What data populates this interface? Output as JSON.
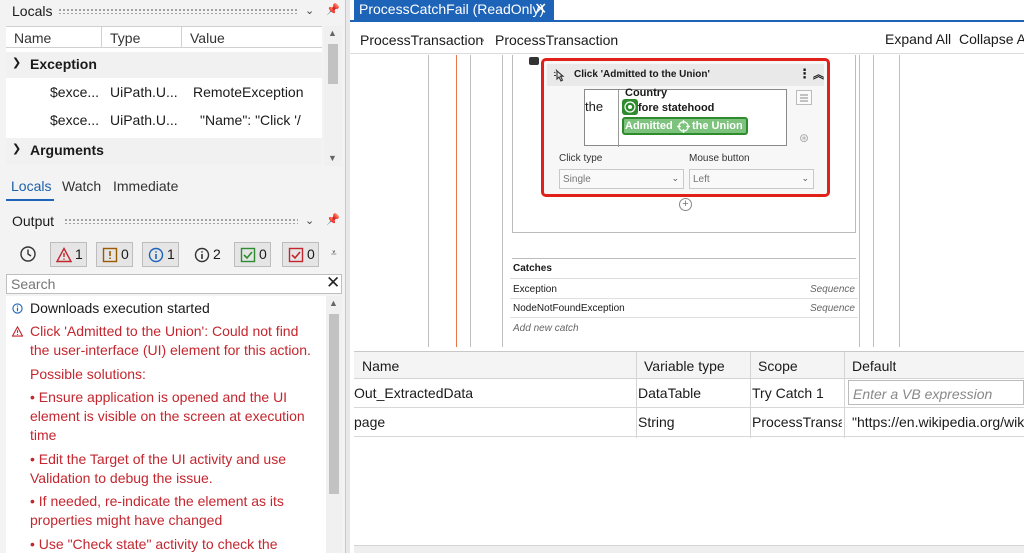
{
  "locals_panel": {
    "title": "Locals",
    "columns": [
      "Name",
      "Type",
      "Value"
    ],
    "groups": [
      {
        "label": "Exception",
        "rows": [
          {
            "name": "$exce...",
            "type": "UiPath.U...",
            "value": "RemoteException"
          },
          {
            "name": "$exce...",
            "type": "UiPath.U...",
            "value": "\"Name\": \"Click '/"
          }
        ]
      },
      {
        "label": "Arguments",
        "rows": []
      }
    ],
    "tabs": [
      "Locals",
      "Watch",
      "Immediate"
    ]
  },
  "output_panel": {
    "title": "Output",
    "filters": [
      {
        "icon": "warning-triangle-icon",
        "count": "1",
        "color": "#c4262e"
      },
      {
        "icon": "error-square-icon",
        "count": "0",
        "color": "#9a5a00"
      },
      {
        "icon": "info-circle-icon",
        "count": "1",
        "color": "#1d63b8"
      },
      {
        "icon": "info-outline-icon",
        "count": "2",
        "color": "#333333"
      },
      {
        "icon": "check-square-icon",
        "count": "0",
        "color": "#2e8b2e"
      },
      {
        "icon": "check-square-red-icon",
        "count": "0",
        "color": "#c4262e"
      }
    ],
    "search_placeholder": "Search",
    "lines": [
      {
        "text": "Downloads execution started",
        "kind": "info"
      },
      {
        "text": "Click 'Admitted to the Union': Could not find",
        "kind": "error"
      },
      {
        "text": "the user-interface (UI) element for this action.",
        "kind": "error-cont"
      },
      {
        "text": "Possible solutions:",
        "kind": "error-cont"
      },
      {
        "text": "•  Ensure application is opened and the UI",
        "kind": "error-bullet"
      },
      {
        "text": "element is visible on the screen at execution",
        "kind": "error-cont"
      },
      {
        "text": "time",
        "kind": "error-cont"
      },
      {
        "text": "•  Edit the Target of the UI activity and use",
        "kind": "error-bullet"
      },
      {
        "text": "Validation to debug the issue.",
        "kind": "error-cont"
      },
      {
        "text": "•  If needed, re-indicate the element as its",
        "kind": "error-bullet"
      },
      {
        "text": "properties might have changed",
        "kind": "error-cont"
      },
      {
        "text": "•  Use \"Check state\" activity to check the",
        "kind": "error-bullet"
      }
    ]
  },
  "document": {
    "tab_title": "ProcessCatchFail (ReadOnly)",
    "breadcrumb": [
      "ProcessTransaction",
      "ProcessTransaction"
    ],
    "expand_all": "Expand All",
    "collapse_all": "Collapse All"
  },
  "activity": {
    "title": "Click 'Admitted to the Union'",
    "preview_text_the": "the",
    "preview_country": "Country",
    "preview_before": "fore statehood",
    "preview_admitted": "Admitted",
    "preview_union": "the Union",
    "click_type_label": "Click type",
    "click_type_value": "Single",
    "mouse_button_label": "Mouse button",
    "mouse_button_value": "Left"
  },
  "catches": {
    "title": "Catches",
    "rows": [
      {
        "exception": "Exception",
        "handler": "Sequence"
      },
      {
        "exception": "NodeNotFoundException",
        "handler": "Sequence"
      }
    ],
    "add_label": "Add new catch"
  },
  "variables": {
    "columns": [
      "Name",
      "Variable type",
      "Scope",
      "Default"
    ],
    "rows": [
      {
        "name": "Out_ExtractedData",
        "type": "DataTable",
        "scope": "Try Catch 1",
        "default": "Enter a VB expression",
        "default_placeholder": true
      },
      {
        "name": "page",
        "type": "String",
        "scope": "ProcessTransact",
        "default": "\"https://en.wikipedia.org/wik",
        "default_placeholder": false
      }
    ]
  },
  "colors": {
    "accent": "#1d63b8",
    "error": "#c4262e",
    "selection_red": "#e1201a",
    "highlight_green": "#2e8b2e"
  }
}
